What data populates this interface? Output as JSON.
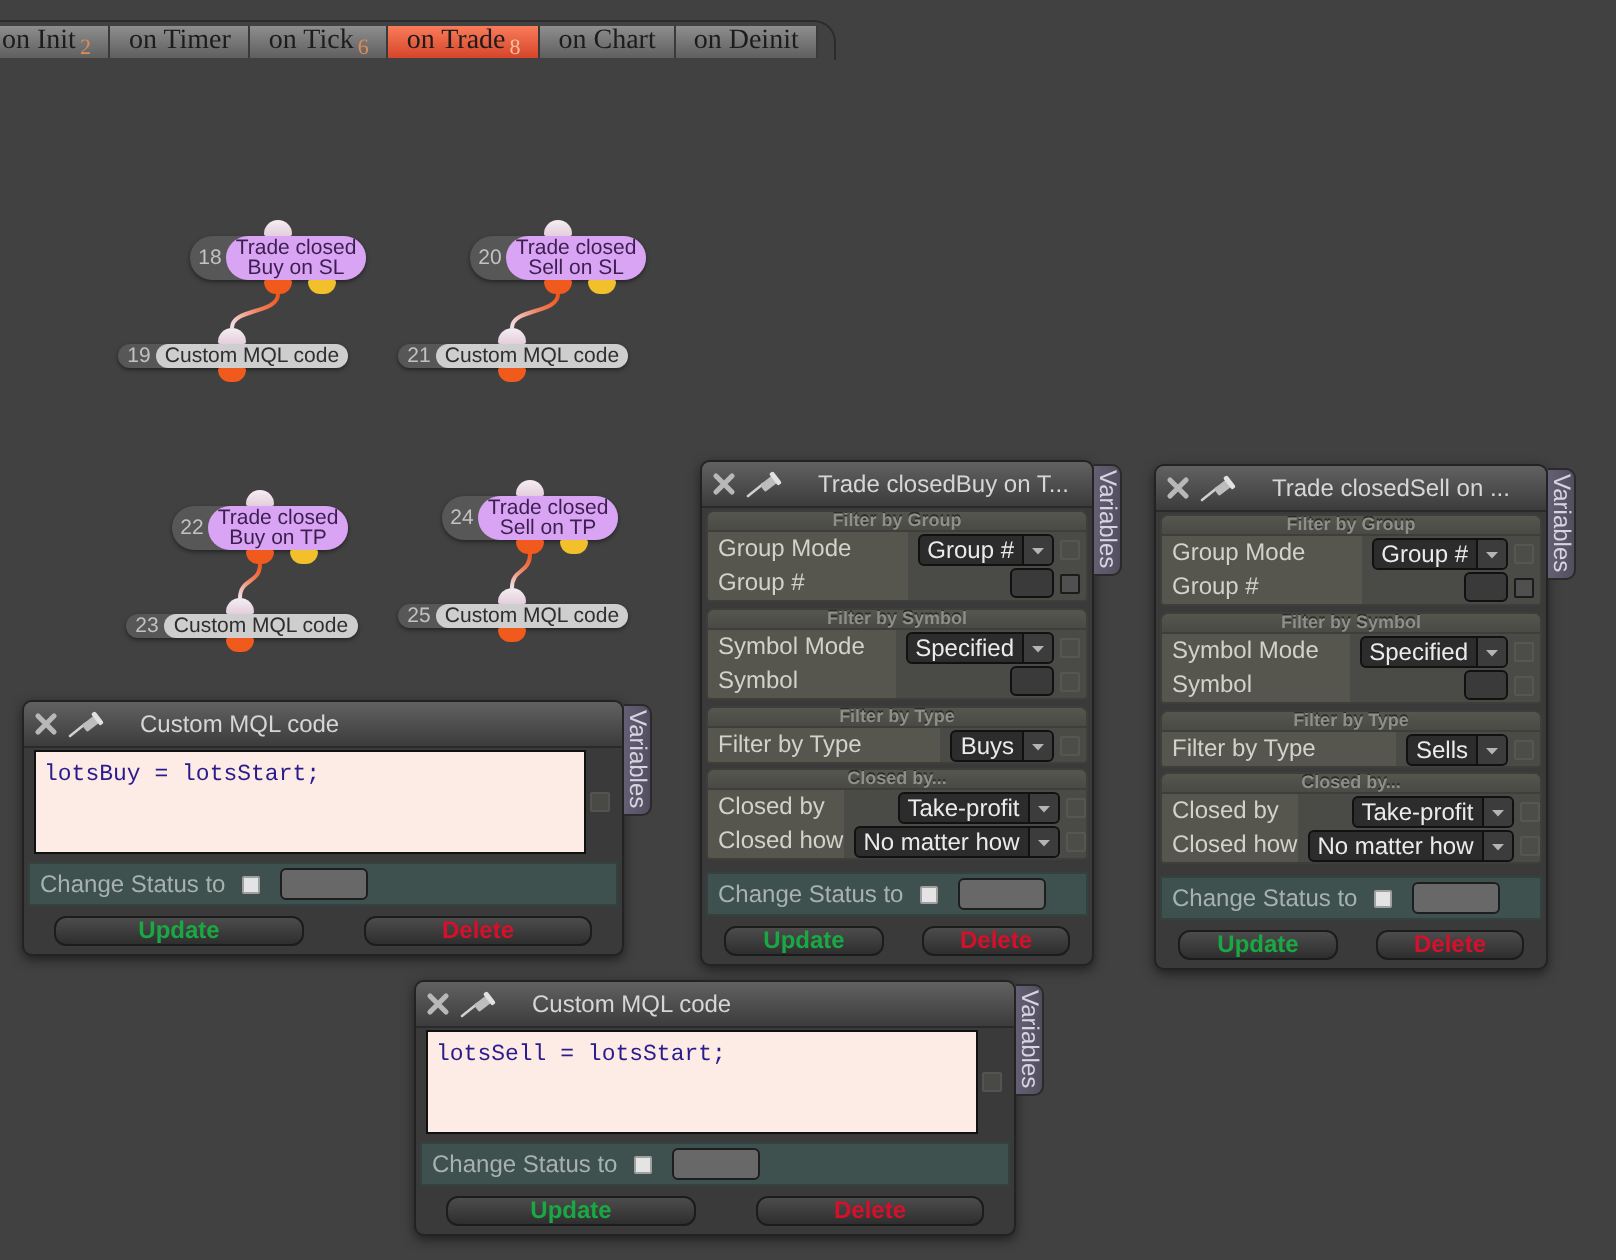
{
  "tabs": [
    {
      "label": "on Init",
      "count": "2",
      "selected": false
    },
    {
      "label": "on Timer",
      "selected": false
    },
    {
      "label": "on Tick",
      "count": "6",
      "selected": false
    },
    {
      "label": "on Trade",
      "count": "8",
      "selected": true
    },
    {
      "label": "on Chart",
      "selected": false
    },
    {
      "label": "on Deinit",
      "selected": false
    }
  ],
  "flows": [
    {
      "trigger": {
        "number": "18",
        "title": [
          "Trade closed",
          "Buy on SL"
        ]
      },
      "action": {
        "number": "19",
        "title": "Custom MQL code"
      }
    },
    {
      "trigger": {
        "number": "20",
        "title": [
          "Trade closed",
          "Sell on SL"
        ]
      },
      "action": {
        "number": "21",
        "title": "Custom MQL code"
      }
    },
    {
      "trigger": {
        "number": "22",
        "title": [
          "Trade closed",
          "Buy on TP"
        ]
      },
      "action": {
        "number": "23",
        "title": "Custom MQL code"
      }
    },
    {
      "trigger": {
        "number": "24",
        "title": [
          "Trade closed",
          "Sell on TP"
        ]
      },
      "action": {
        "number": "25",
        "title": "Custom MQL code"
      }
    }
  ],
  "panels": [
    {
      "kind": "filter",
      "title": "Trade closedBuy on T...",
      "side_tab": "Variables",
      "sections": [
        {
          "heading": "Filter by Group",
          "rows": [
            {
              "label": "Group Mode",
              "kind": "dropdown",
              "value": "Group #",
              "toggle": {
                "checked": false,
                "disabled": true
              }
            },
            {
              "label": "Group #",
              "kind": "input",
              "toggle": {
                "checked": false,
                "disabled": false
              }
            }
          ]
        },
        {
          "heading": "Filter by Symbol",
          "rows": [
            {
              "label": "Symbol Mode",
              "kind": "dropdown",
              "value": "Specified",
              "toggle": {
                "checked": false,
                "disabled": true
              }
            },
            {
              "label": "Symbol",
              "kind": "input",
              "toggle": {
                "checked": false,
                "disabled": true
              }
            }
          ]
        },
        {
          "heading": "Filter by Type",
          "rows": [
            {
              "label": "Filter by Type",
              "kind": "dropdown",
              "value": "Buys",
              "toggle": {
                "checked": false,
                "disabled": true
              }
            }
          ]
        },
        {
          "heading": "Closed by...",
          "rows": [
            {
              "label": "Closed by",
              "kind": "dropdown",
              "value": "Take-profit",
              "toggle": {
                "checked": false,
                "disabled": true
              }
            },
            {
              "label": "Closed how",
              "kind": "dropdown",
              "value": "No matter how",
              "toggle": {
                "checked": false,
                "disabled": true
              }
            }
          ]
        }
      ],
      "status": {
        "label": "Change Status to",
        "checked": false
      },
      "buttons": [
        {
          "label": "Update",
          "kind": "update"
        },
        {
          "label": "Delete",
          "kind": "delete"
        }
      ]
    },
    {
      "kind": "filter",
      "title": "Trade closedSell on ...",
      "side_tab": "Variables",
      "sections": [
        {
          "heading": "Filter by Group",
          "rows": [
            {
              "label": "Group Mode",
              "kind": "dropdown",
              "value": "Group #",
              "toggle": {
                "checked": false,
                "disabled": true
              }
            },
            {
              "label": "Group #",
              "kind": "input",
              "toggle": {
                "checked": false,
                "disabled": false
              }
            }
          ]
        },
        {
          "heading": "Filter by Symbol",
          "rows": [
            {
              "label": "Symbol Mode",
              "kind": "dropdown",
              "value": "Specified",
              "toggle": {
                "checked": false,
                "disabled": true
              }
            },
            {
              "label": "Symbol",
              "kind": "input",
              "toggle": {
                "checked": false,
                "disabled": true
              }
            }
          ]
        },
        {
          "heading": "Filter by Type",
          "rows": [
            {
              "label": "Filter by Type",
              "kind": "dropdown",
              "value": "Sells",
              "toggle": {
                "checked": false,
                "disabled": true
              }
            }
          ]
        },
        {
          "heading": "Closed by...",
          "rows": [
            {
              "label": "Closed by",
              "kind": "dropdown",
              "value": "Take-profit",
              "toggle": {
                "checked": false,
                "disabled": true
              }
            },
            {
              "label": "Closed how",
              "kind": "dropdown",
              "value": "No matter how",
              "toggle": {
                "checked": false,
                "disabled": true
              }
            }
          ]
        }
      ],
      "status": {
        "label": "Change Status to",
        "checked": false
      },
      "buttons": [
        {
          "label": "Update",
          "kind": "update"
        },
        {
          "label": "Delete",
          "kind": "delete"
        }
      ]
    },
    {
      "kind": "code",
      "title": "Custom MQL code",
      "side_tab": "Variables",
      "code": "lotsBuy = lotsStart;",
      "code_toggle": {
        "checked": false,
        "disabled": true
      },
      "status": {
        "label": "Change Status to",
        "checked": false
      },
      "buttons": [
        {
          "label": "Update",
          "kind": "update"
        },
        {
          "label": "Delete",
          "kind": "delete"
        }
      ]
    },
    {
      "kind": "code",
      "title": "Custom MQL code",
      "side_tab": "Variables",
      "code": "lotsSell = lotsStart;",
      "code_toggle": {
        "checked": false,
        "disabled": true
      },
      "status": {
        "label": "Change Status to",
        "checked": false
      },
      "buttons": [
        {
          "label": "Update",
          "kind": "update"
        },
        {
          "label": "Delete",
          "kind": "delete"
        }
      ]
    }
  ]
}
